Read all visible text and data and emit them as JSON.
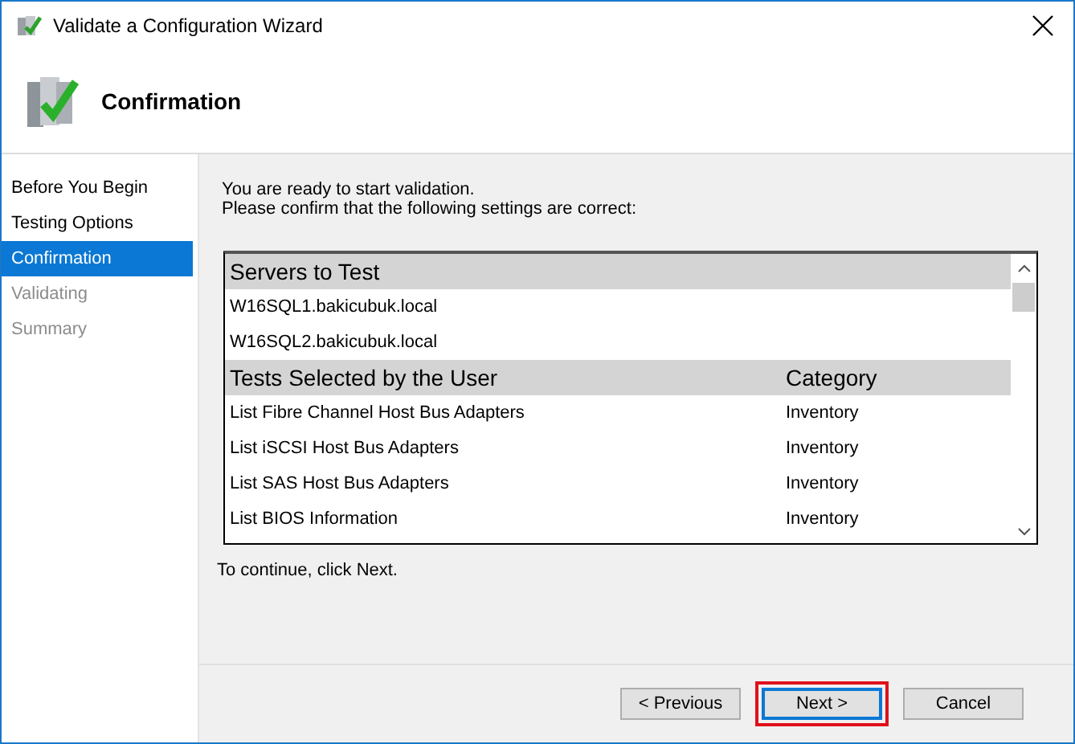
{
  "window": {
    "title": "Validate a Configuration Wizard"
  },
  "header": {
    "title": "Confirmation"
  },
  "sidebar": {
    "items": [
      {
        "label": "Before You Begin",
        "selected": false,
        "disabled": false
      },
      {
        "label": "Testing Options",
        "selected": false,
        "disabled": false
      },
      {
        "label": "Confirmation",
        "selected": true,
        "disabled": false
      },
      {
        "label": "Validating",
        "selected": false,
        "disabled": true
      },
      {
        "label": "Summary",
        "selected": false,
        "disabled": true
      }
    ]
  },
  "intro": [
    "You are ready to start validation.",
    "Please confirm that the following settings are correct:"
  ],
  "list": {
    "rows": [
      {
        "kind": "header",
        "text": "Servers to Test"
      },
      {
        "kind": "item",
        "text": "W16SQL1.bakicubuk.local"
      },
      {
        "kind": "item",
        "text": "W16SQL2.bakicubuk.local"
      },
      {
        "kind": "header",
        "text": "Tests Selected by the User",
        "category": "Category"
      },
      {
        "kind": "item",
        "text": "List Fibre Channel Host Bus Adapters",
        "category": "Inventory"
      },
      {
        "kind": "item",
        "text": "List iSCSI Host Bus Adapters",
        "category": "Inventory"
      },
      {
        "kind": "item",
        "text": "List SAS Host Bus Adapters",
        "category": "Inventory"
      },
      {
        "kind": "item",
        "text": "List BIOS Information",
        "category": "Inventory"
      }
    ]
  },
  "footer_note": "To continue, click Next.",
  "buttons": [
    {
      "label": "< Previous",
      "default": false,
      "highlighted": false
    },
    {
      "label": "Next >",
      "default": true,
      "highlighted": true
    },
    {
      "label": "Cancel",
      "default": false,
      "highlighted": false
    }
  ]
}
